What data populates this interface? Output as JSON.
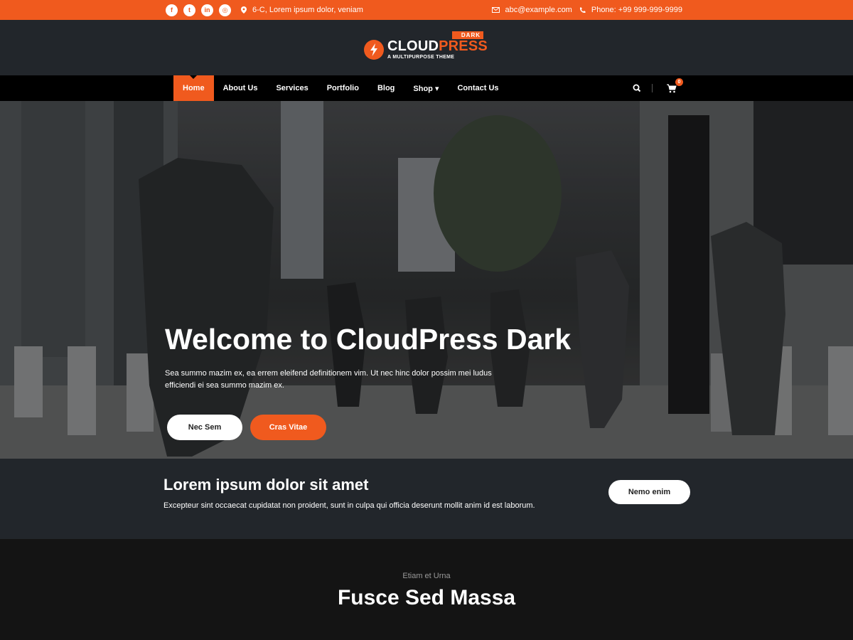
{
  "topbar": {
    "address": "6-C, Lorem ipsum dolor, veniam",
    "email": "abc@example.com",
    "phone": "Phone: +99 999-999-9999",
    "social_icons": [
      "facebook-icon",
      "twitter-icon",
      "linkedin-icon",
      "instagram-icon"
    ]
  },
  "logo": {
    "name_part1": "CLOUD",
    "name_part2": "PRESS",
    "badge": "DARK",
    "tagline": "A MULTIPURPOSE THEME"
  },
  "nav": {
    "items": [
      {
        "label": "Home",
        "active": true
      },
      {
        "label": "About Us"
      },
      {
        "label": "Services"
      },
      {
        "label": "Portfolio"
      },
      {
        "label": "Blog"
      },
      {
        "label": "Shop ▾"
      },
      {
        "label": "Contact Us"
      }
    ],
    "cart_count": "0"
  },
  "hero": {
    "title": "Welcome to CloudPress Dark",
    "description": "Sea summo mazim ex, ea errem eleifend definitionem vim. Ut nec hinc dolor possim mei ludus efficiendi ei sea summo mazim ex.",
    "button_primary": "Nec Sem",
    "button_secondary": "Cras Vitae"
  },
  "cta": {
    "title": "Lorem ipsum dolor sit amet",
    "text": "Excepteur sint occaecat cupidatat non proident, sunt in culpa qui officia deserunt mollit anim id est laborum.",
    "button": "Nemo enim"
  },
  "section": {
    "subtitle": "Etiam et Urna",
    "title": "Fusce Sed Massa"
  },
  "colors": {
    "accent": "#f05a1e",
    "dark": "#22262b",
    "nav": "#000000"
  }
}
